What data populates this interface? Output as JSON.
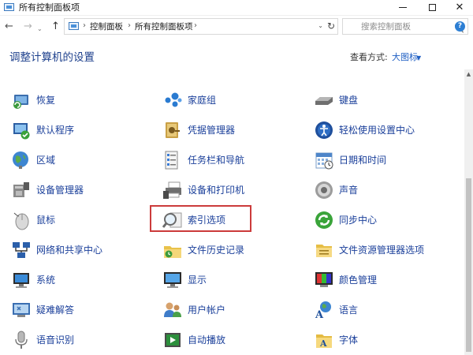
{
  "window": {
    "title": "所有控制面板项",
    "minimize_glyph": "",
    "maximize_glyph": "",
    "close_glyph": "✕"
  },
  "address": {
    "crumbs": [
      "控制面板",
      "所有控制面板项"
    ],
    "separator": "›",
    "dropdown_glyph": "⌄",
    "refresh_glyph": "↻"
  },
  "nav": {
    "back_glyph": "←",
    "forward_glyph": "→",
    "history_glyph": "⌄",
    "up_glyph": "↑"
  },
  "search": {
    "placeholder": "搜索控制面板"
  },
  "help": {
    "glyph": "?"
  },
  "header": {
    "title": "调整计算机的设置",
    "view_by_label": "查看方式:",
    "view_by_value": "大图标",
    "view_by_caret": "▼"
  },
  "items": [
    {
      "label": "恢复",
      "icon": "recovery-icon"
    },
    {
      "label": "家庭组",
      "icon": "homegroup-icon"
    },
    {
      "label": "键盘",
      "icon": "keyboard-icon"
    },
    {
      "label": "默认程序",
      "icon": "default-programs-icon"
    },
    {
      "label": "凭据管理器",
      "icon": "credential-manager-icon"
    },
    {
      "label": "轻松使用设置中心",
      "icon": "ease-of-access-icon"
    },
    {
      "label": "区域",
      "icon": "region-icon"
    },
    {
      "label": "任务栏和导航",
      "icon": "taskbar-icon"
    },
    {
      "label": "日期和时间",
      "icon": "date-time-icon"
    },
    {
      "label": "设备管理器",
      "icon": "device-manager-icon"
    },
    {
      "label": "设备和打印机",
      "icon": "devices-printers-icon"
    },
    {
      "label": "声音",
      "icon": "sound-icon"
    },
    {
      "label": "鼠标",
      "icon": "mouse-icon"
    },
    {
      "label": "索引选项",
      "icon": "indexing-options-icon",
      "highlighted": true
    },
    {
      "label": "同步中心",
      "icon": "sync-center-icon"
    },
    {
      "label": "网络和共享中心",
      "icon": "network-sharing-icon"
    },
    {
      "label": "文件历史记录",
      "icon": "file-history-icon"
    },
    {
      "label": "文件资源管理器选项",
      "icon": "explorer-options-icon"
    },
    {
      "label": "系统",
      "icon": "system-icon"
    },
    {
      "label": "显示",
      "icon": "display-icon"
    },
    {
      "label": "颜色管理",
      "icon": "color-management-icon"
    },
    {
      "label": "疑难解答",
      "icon": "troubleshooting-icon"
    },
    {
      "label": "用户帐户",
      "icon": "user-accounts-icon"
    },
    {
      "label": "语言",
      "icon": "language-icon"
    },
    {
      "label": "语音识别",
      "icon": "speech-recognition-icon"
    },
    {
      "label": "自动播放",
      "icon": "autoplay-icon"
    },
    {
      "label": "字体",
      "icon": "fonts-icon"
    }
  ],
  "colors": {
    "link": "#1a3f9a",
    "heading": "#1c3f8c",
    "highlight_border": "#cc3b3b"
  }
}
